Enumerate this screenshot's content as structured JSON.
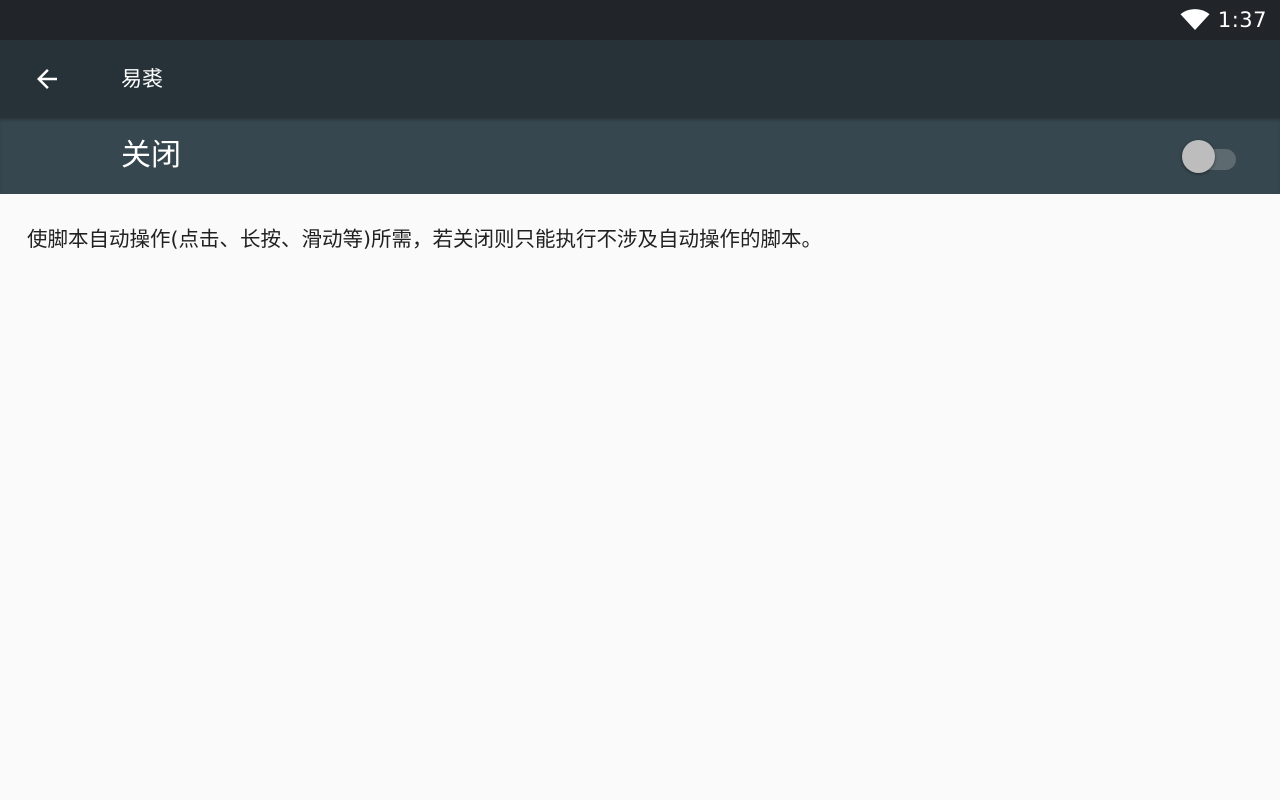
{
  "status_bar": {
    "time": "1:37",
    "wifi_icon": "wifi-full-icon"
  },
  "toolbar": {
    "back_icon": "arrow-back-icon",
    "title": "易裘"
  },
  "accessibility_switch": {
    "label": "关闭",
    "checked": false
  },
  "description": "使脚本自动操作(点击、长按、滑动等)所需，若关闭则只能执行不涉及自动操作的脚本。",
  "colors": {
    "status_bar": "#212529",
    "toolbar": "#263238",
    "switch_bar": "#37474f",
    "background": "#fafafa",
    "text": "#212121"
  }
}
